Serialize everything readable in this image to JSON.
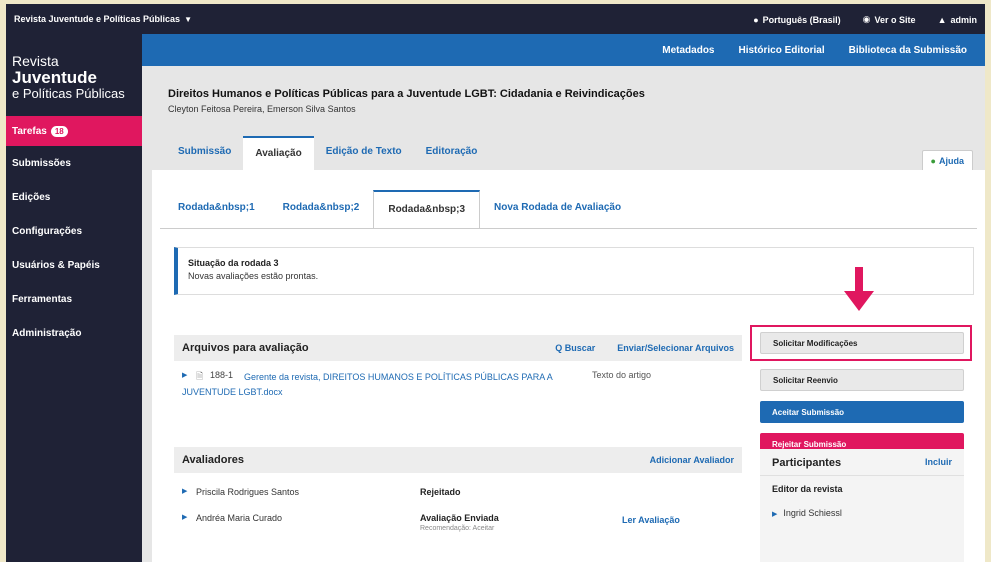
{
  "topbar": {
    "site": "Revista Juventude e Políticas Públicas",
    "language": "Português (Brasil)",
    "view_site": "Ver o Site",
    "user": "admin"
  },
  "sidebar": {
    "logo": {
      "line1": "Revista",
      "line2": "Juventude",
      "line3": "e Políticas Públicas"
    },
    "items": [
      {
        "label": "Tarefas",
        "badge": "18"
      },
      {
        "label": "Submissões"
      },
      {
        "label": "Edições"
      },
      {
        "label": "Configurações"
      },
      {
        "label": "Usuários & Papéis"
      },
      {
        "label": "Ferramentas"
      },
      {
        "label": "Administração"
      }
    ]
  },
  "header_links": [
    "Metadados",
    "Histórico Editorial",
    "Biblioteca da Submissão"
  ],
  "submission": {
    "title": "Direitos Humanos e Políticas Públicas para a Juventude LGBT: Cidadania e Reivindicações",
    "authors": "Cleyton Feitosa Pereira, Emerson Silva Santos"
  },
  "tabs": [
    "Submissão",
    "Avaliação",
    "Edição de Texto",
    "Editoração"
  ],
  "help": "Ajuda",
  "round_tabs": [
    "Rodada&nbsp;1",
    "Rodada&nbsp;2",
    "Rodada&nbsp;3",
    "Nova Rodada de Avaliação"
  ],
  "round_status": {
    "heading": "Situação da rodada 3",
    "text": "Novas avaliações estão prontas."
  },
  "files": {
    "heading": "Arquivos para avaliação",
    "search": "Buscar",
    "upload": "Enviar/Selecionar Arquivos",
    "items": [
      {
        "id": "188-1",
        "name": "Gerente da revista, DIREITOS HUMANOS E POLÍTICAS PÚBLICAS PARA A JUVENTUDE LGBT.docx",
        "type": "Texto do artigo"
      }
    ]
  },
  "reviewers": {
    "heading": "Avaliadores",
    "add": "Adicionar Avaliador",
    "items": [
      {
        "name": "Priscila Rodrigues Santos",
        "status": "Rejeitado",
        "recommendation": "",
        "link": ""
      },
      {
        "name": "Andréa Maria Curado",
        "status": "Avaliação Enviada",
        "recommendation": "Recomendação: Aceitar",
        "link": "Ler Avaliação"
      }
    ]
  },
  "actions": {
    "request_revisions": "Solicitar Modificações",
    "resubmit": "Solicitar Reenvio",
    "accept": "Aceitar Submissão",
    "decline": "Rejeitar Submissão"
  },
  "participants": {
    "heading": "Participantes",
    "add": "Incluir",
    "role": "Editor da revista",
    "person": "Ingrid Schiessl"
  },
  "colors": {
    "navy": "#1f2236",
    "blue": "#1e6ab3",
    "pink": "#e0175f"
  }
}
